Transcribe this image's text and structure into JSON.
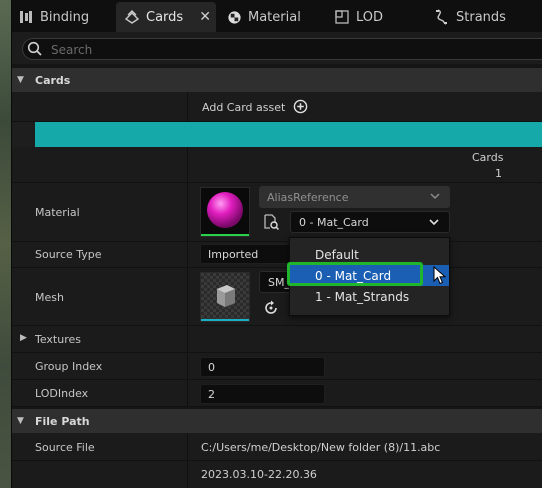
{
  "tabs": [
    {
      "label": "Binding",
      "icon": "binding-icon"
    },
    {
      "label": "Cards",
      "icon": "cards-icon",
      "active": true
    },
    {
      "label": "Material",
      "icon": "material-icon"
    },
    {
      "label": "LOD",
      "icon": "lod-icon"
    },
    {
      "label": "Strands",
      "icon": "strands-icon"
    }
  ],
  "search": {
    "placeholder": "Search"
  },
  "cards_section": {
    "title": "Cards",
    "add_label": "Add Card asset",
    "column_header": "Cards",
    "column_value": "1",
    "accent_color": "#15a9aa"
  },
  "material": {
    "label": "Material",
    "reference": "AliasReference",
    "selected": "0 - Mat_Card",
    "options": [
      "Default",
      "0 - Mat_Card",
      "1 - Mat_Strands"
    ],
    "swatch_color": "#e21ec0"
  },
  "source_type": {
    "label": "Source Type",
    "value": "Imported"
  },
  "mesh": {
    "label": "Mesh",
    "value": "SM_"
  },
  "textures": {
    "label": "Textures"
  },
  "group_index": {
    "label": "Group Index",
    "value": "0"
  },
  "lod_index": {
    "label": "LODIndex",
    "value": "2"
  },
  "file_path": {
    "title": "File Path",
    "source_label": "Source File",
    "source_value": "C:/Users/me/Desktop/New folder (8)/11.abc",
    "timestamp": "2023.03.10-22.20.36"
  },
  "colors": {
    "highlight": "#1fb52c",
    "selection": "#1a5fb4"
  }
}
